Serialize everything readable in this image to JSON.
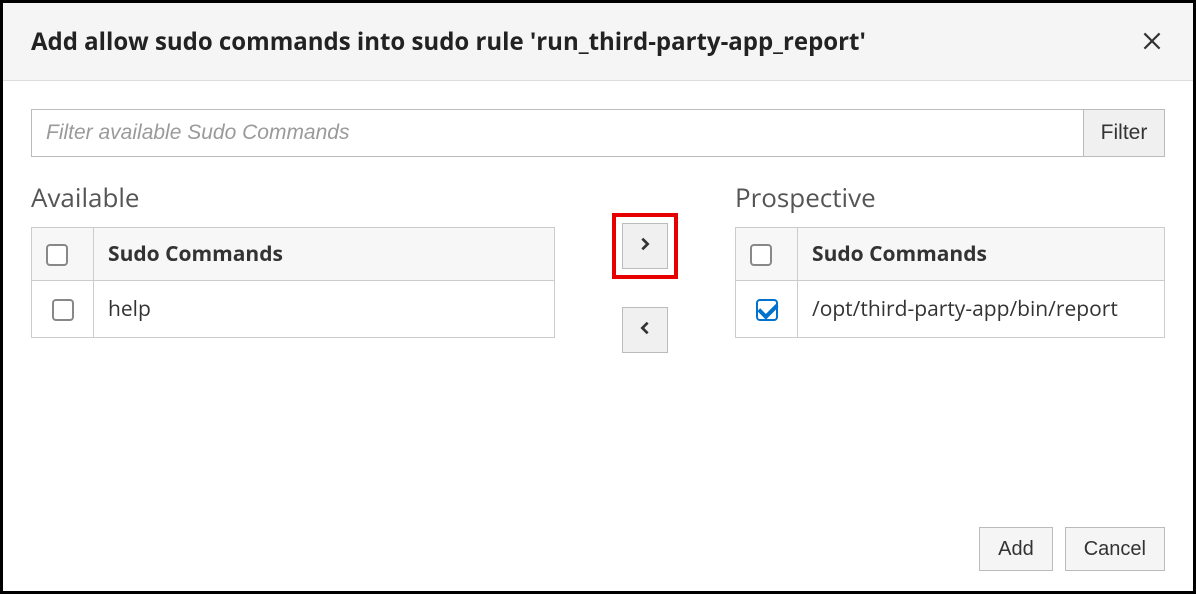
{
  "dialog": {
    "title": "Add allow sudo commands into sudo rule 'run_third-party-app_report'"
  },
  "filter": {
    "placeholder": "Filter available Sudo Commands",
    "button": "Filter"
  },
  "available": {
    "heading": "Available",
    "column": "Sudo Commands",
    "rows": [
      {
        "checked": false,
        "command": "help"
      }
    ]
  },
  "prospective": {
    "heading": "Prospective",
    "column": "Sudo Commands",
    "rows": [
      {
        "checked": true,
        "command": "/opt/third-party-app/bin/report"
      }
    ]
  },
  "footer": {
    "add": "Add",
    "cancel": "Cancel"
  }
}
